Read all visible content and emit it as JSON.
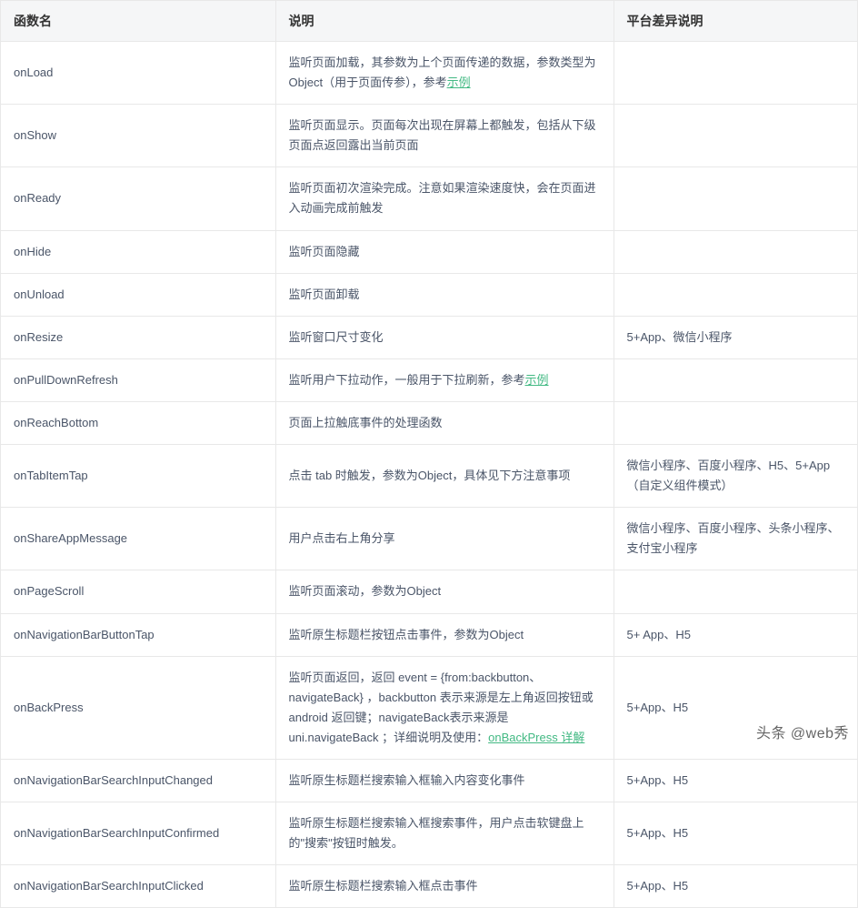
{
  "headers": {
    "col1": "函数名",
    "col2": "说明",
    "col3": "平台差异说明"
  },
  "rows": [
    {
      "name": "onLoad",
      "desc_pre": "监听页面加载，其参数为上个页面传递的数据，参数类型为Object（用于页面传参），参考",
      "desc_link": "示例",
      "desc_post": "",
      "platform": ""
    },
    {
      "name": "onShow",
      "desc_pre": "监听页面显示。页面每次出现在屏幕上都触发，包括从下级页面点返回露出当前页面",
      "desc_link": "",
      "desc_post": "",
      "platform": ""
    },
    {
      "name": "onReady",
      "desc_pre": "监听页面初次渲染完成。注意如果渲染速度快，会在页面进入动画完成前触发",
      "desc_link": "",
      "desc_post": "",
      "platform": ""
    },
    {
      "name": "onHide",
      "desc_pre": "监听页面隐藏",
      "desc_link": "",
      "desc_post": "",
      "platform": ""
    },
    {
      "name": "onUnload",
      "desc_pre": "监听页面卸载",
      "desc_link": "",
      "desc_post": "",
      "platform": ""
    },
    {
      "name": "onResize",
      "desc_pre": "监听窗口尺寸变化",
      "desc_link": "",
      "desc_post": "",
      "platform": "5+App、微信小程序"
    },
    {
      "name": "onPullDownRefresh",
      "desc_pre": "监听用户下拉动作，一般用于下拉刷新，参考",
      "desc_link": "示例",
      "desc_post": "",
      "platform": ""
    },
    {
      "name": "onReachBottom",
      "desc_pre": "页面上拉触底事件的处理函数",
      "desc_link": "",
      "desc_post": "",
      "platform": ""
    },
    {
      "name": "onTabItemTap",
      "desc_pre": "点击 tab 时触发，参数为Object，具体见下方注意事项",
      "desc_link": "",
      "desc_post": "",
      "platform": "微信小程序、百度小程序、H5、5+App（自定义组件模式）"
    },
    {
      "name": "onShareAppMessage",
      "desc_pre": "用户点击右上角分享",
      "desc_link": "",
      "desc_post": "",
      "platform": "微信小程序、百度小程序、头条小程序、支付宝小程序"
    },
    {
      "name": "onPageScroll",
      "desc_pre": "监听页面滚动，参数为Object",
      "desc_link": "",
      "desc_post": "",
      "platform": ""
    },
    {
      "name": "onNavigationBarButtonTap",
      "desc_pre": "监听原生标题栏按钮点击事件，参数为Object",
      "desc_link": "",
      "desc_post": "",
      "platform": "5+ App、H5"
    },
    {
      "name": "onBackPress",
      "desc_pre": "监听页面返回，返回 event = {from:backbutton、navigateBack} ，backbutton 表示来源是左上角返回按钮或 android 返回键；navigateBack表示来源是 uni.navigateBack ；详细说明及使用：",
      "desc_link": "onBackPress 详解",
      "desc_post": "",
      "platform": "5+App、H5"
    },
    {
      "name": "onNavigationBarSearchInputChanged",
      "desc_pre": "监听原生标题栏搜索输入框输入内容变化事件",
      "desc_link": "",
      "desc_post": "",
      "platform": "5+App、H5"
    },
    {
      "name": "onNavigationBarSearchInputConfirmed",
      "desc_pre": "监听原生标题栏搜索输入框搜索事件，用户点击软键盘上的\"搜索\"按钮时触发。",
      "desc_link": "",
      "desc_post": "",
      "platform": "5+App、H5"
    },
    {
      "name": "onNavigationBarSearchInputClicked",
      "desc_pre": "监听原生标题栏搜索输入框点击事件",
      "desc_link": "",
      "desc_post": "",
      "platform": "5+App、H5"
    }
  ],
  "watermark": "头条 @web秀"
}
